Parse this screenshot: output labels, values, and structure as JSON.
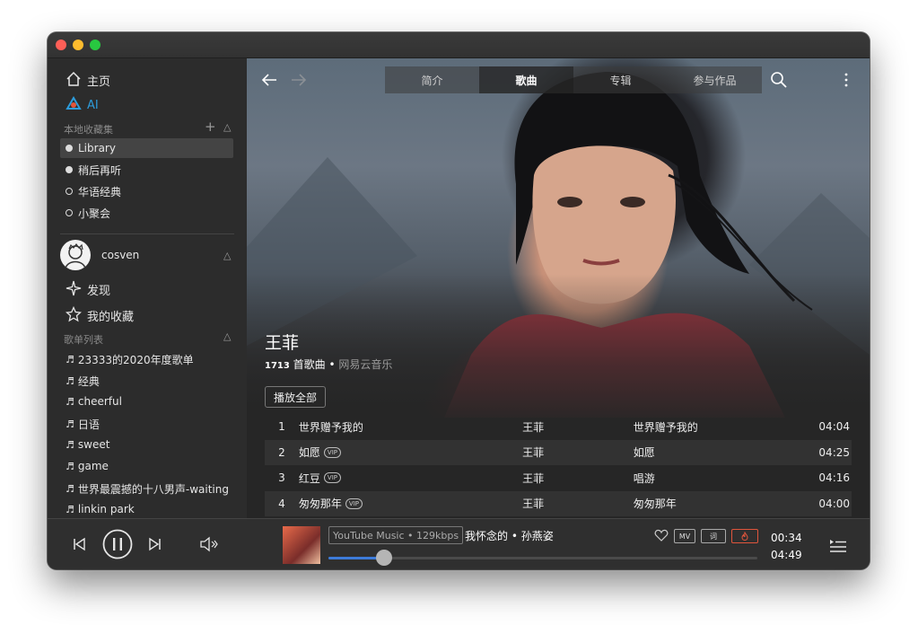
{
  "sidebar": {
    "home_label": "主页",
    "ai_label": "AI",
    "local_section": "本地收藏集",
    "local_items": [
      "Library",
      "稍后再听",
      "华语经典",
      "小聚会"
    ],
    "user_name": "cosven",
    "discover_label": "发现",
    "favorites_label": "我的收藏",
    "playlist_section": "歌单列表",
    "playlists": [
      "23333的2020年度歌单",
      "经典",
      "cheerful",
      "日语",
      "sweet",
      "game",
      "世界最震撼的十八男声-waiting",
      "linkin park"
    ]
  },
  "header": {
    "tabs": [
      "简介",
      "歌曲",
      "专辑",
      "参与作品"
    ],
    "active_tab": "歌曲"
  },
  "artist": {
    "name": "王菲",
    "song_count": "1713",
    "song_count_label": "首歌曲",
    "separator": "•",
    "source": "网易云音乐",
    "play_all": "播放全部"
  },
  "songs": [
    {
      "index": "1",
      "title": "世界赠予我的",
      "vip": false,
      "artist": "王菲",
      "album": "世界赠予我的",
      "duration": "04:04"
    },
    {
      "index": "2",
      "title": "如愿",
      "vip": true,
      "artist": "王菲",
      "album": "如愿",
      "duration": "04:25"
    },
    {
      "index": "3",
      "title": "红豆",
      "vip": true,
      "artist": "王菲",
      "album": "唱游",
      "duration": "04:16"
    },
    {
      "index": "4",
      "title": "匆匆那年",
      "vip": true,
      "artist": "王菲",
      "album": "匆匆那年",
      "duration": "04:00"
    }
  ],
  "vip_label": "VIP",
  "player": {
    "source_badge": "YouTube Music • 129kbps",
    "now_playing": "我怀念的 • 孙燕姿",
    "mv_label": "MV",
    "lyrics_label": "词",
    "current_time": "00:34",
    "total_time": "04:49",
    "progress": 0.13
  },
  "colors": {
    "accent": "#3d7bd9",
    "ai_accent": "#2d9cdb",
    "hot_badge": "#e0553c"
  }
}
